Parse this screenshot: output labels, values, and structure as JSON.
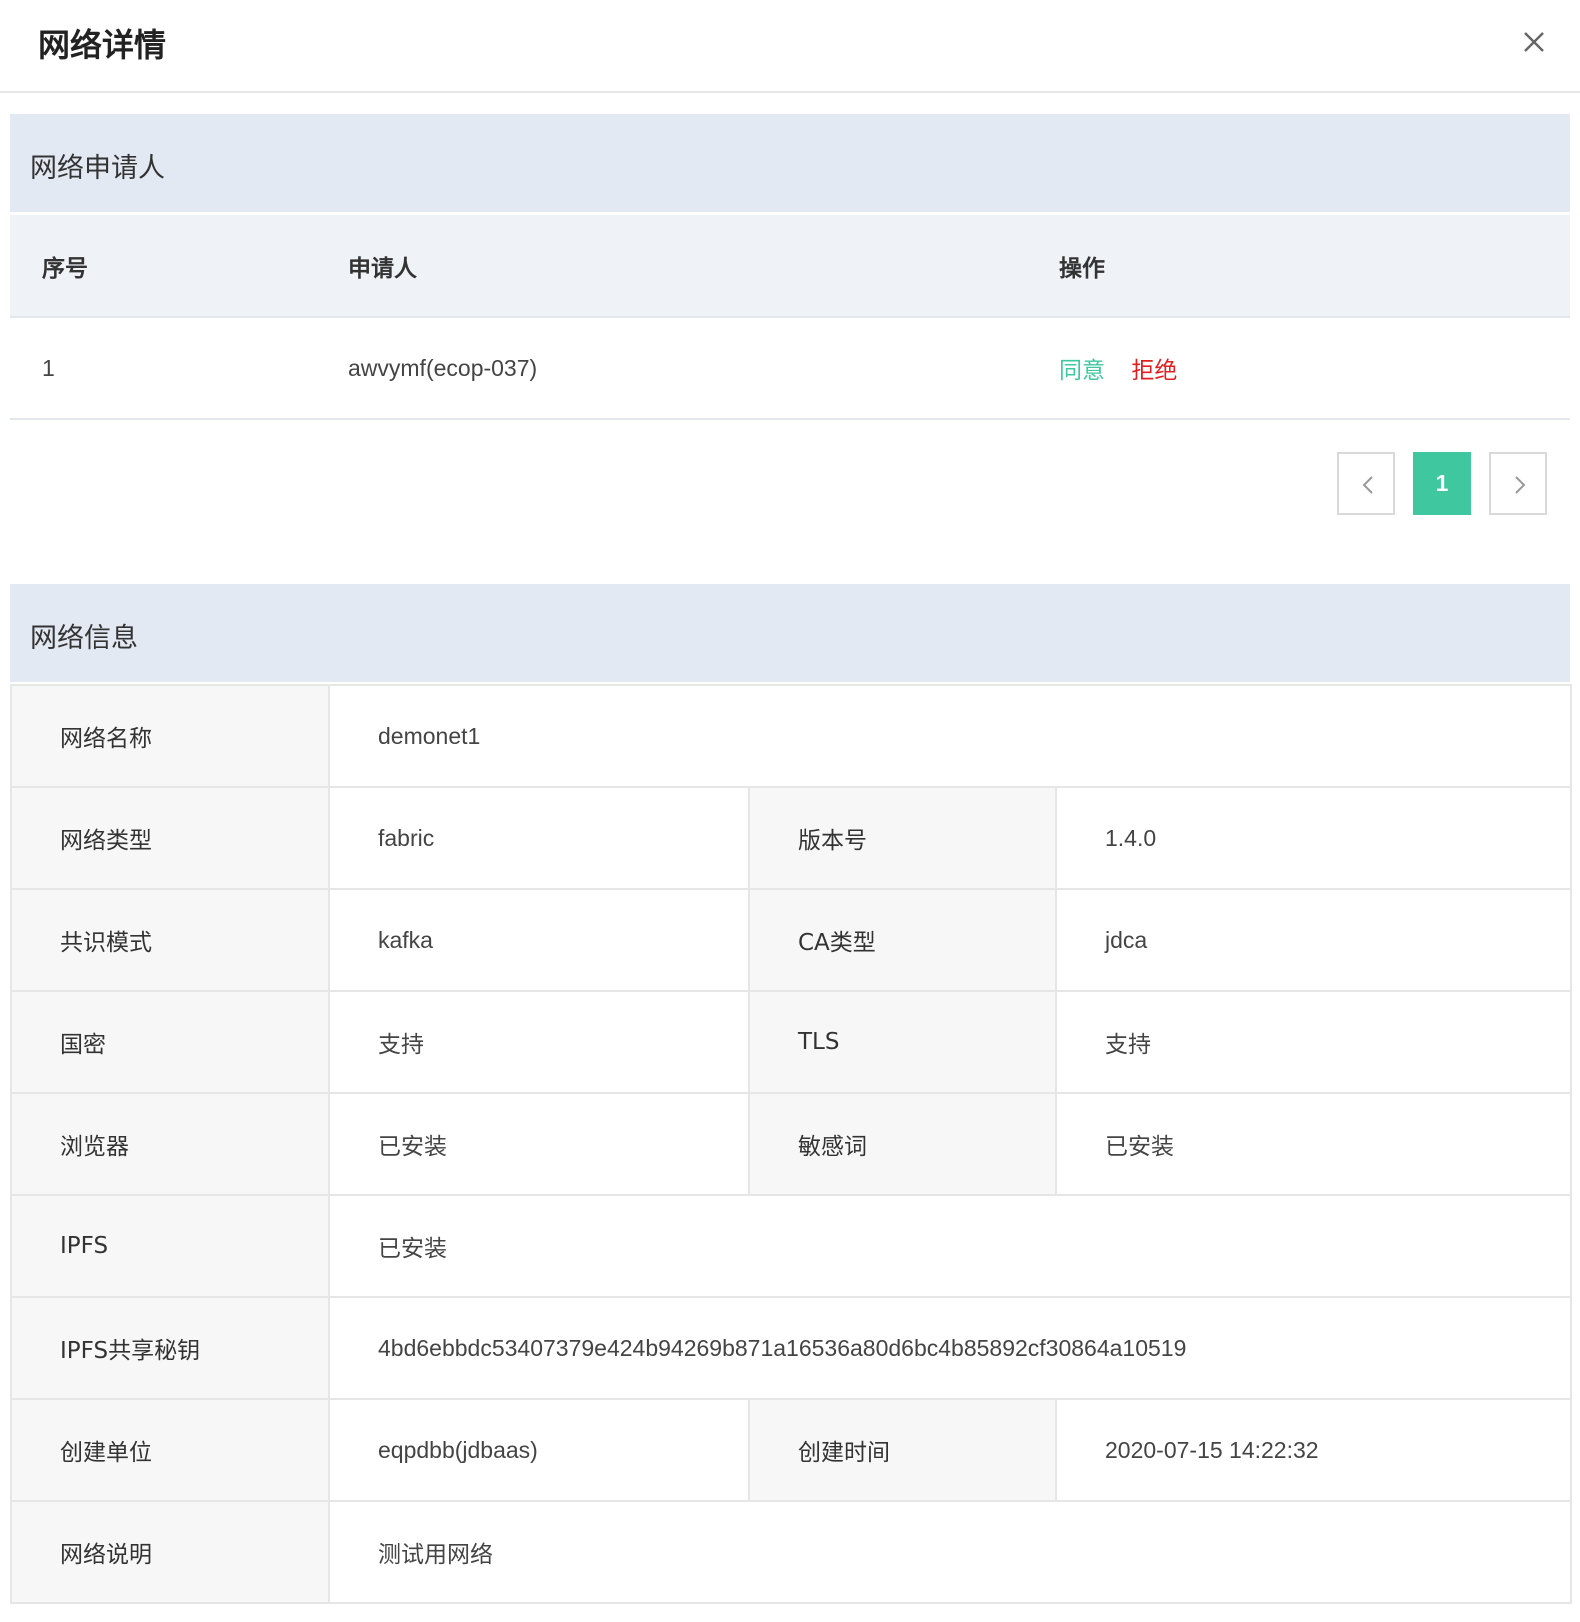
{
  "dialog": {
    "title": "网络详情",
    "close_icon": "close-icon"
  },
  "applicants": {
    "section_title": "网络申请人",
    "columns": [
      "序号",
      "申请人",
      "操作"
    ],
    "rows": [
      {
        "index": "1",
        "applicant": "awvymf(ecop-037)",
        "agree_label": "同意",
        "reject_label": "拒绝"
      }
    ]
  },
  "pagination": {
    "current_page": "1",
    "prev_icon": "chevron-left-icon",
    "next_icon": "chevron-right-icon"
  },
  "network_info": {
    "section_title": "网络信息",
    "name_label": "网络名称",
    "name_value": "demonet1",
    "type_label": "网络类型",
    "type_value": "fabric",
    "version_label": "版本号",
    "version_value": "1.4.0",
    "consensus_label": "共识模式",
    "consensus_value": "kafka",
    "ca_label": "CA类型",
    "ca_value": "jdca",
    "gm_label": "国密",
    "gm_value": "支持",
    "tls_label": "TLS",
    "tls_value": "支持",
    "browser_label": "浏览器",
    "browser_value": "已安装",
    "sensitive_label": "敏感词",
    "sensitive_value": "已安装",
    "ipfs_label": "IPFS",
    "ipfs_value": "已安装",
    "ipfs_key_label": "IPFS共享秘钥",
    "ipfs_key_value": "4bd6ebbdc53407379e424b94269b871a16536a80d6bc4b85892cf30864a10519",
    "org_label": "创建单位",
    "org_value": "eqpdbb(jdbaas)",
    "created_label": "创建时间",
    "created_value": "2020-07-15 14:22:32",
    "desc_label": "网络说明",
    "desc_value": "测试用网络"
  },
  "colors": {
    "accent": "#3fc8a0",
    "danger": "#e02020",
    "section_bg": "#e3e9f2"
  }
}
